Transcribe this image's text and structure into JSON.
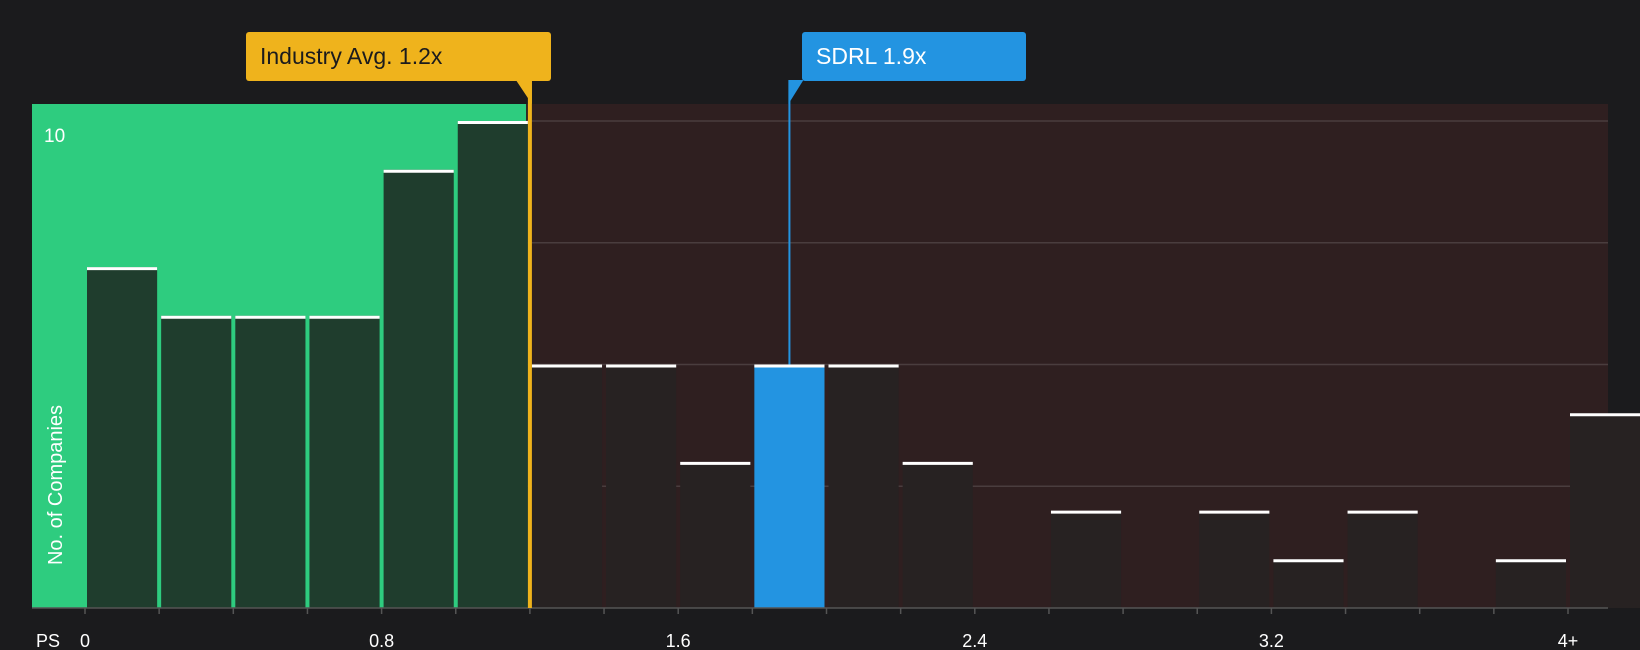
{
  "colors": {
    "background": "#1b1b1d",
    "below_industry_fill": "#2ecc7f",
    "above_industry_fill": "#2f1f20",
    "bar_below": "#1f3d2d",
    "bar_above": "#272222",
    "bar_highlight": "#2394e1",
    "industry_marker": "#efb31c",
    "company_marker": "#2394e1",
    "cap_line": "#ffffff",
    "gridline": "#4a3d3e",
    "axis_text": "#ffffff"
  },
  "callouts": {
    "industry_label": "Industry Avg. 1.2x",
    "company_label": "SDRL 1.9x"
  },
  "chart_data": {
    "type": "bar",
    "x_label": "PS",
    "y_label": "No. of Companies",
    "bin_width": 0.2,
    "x_ticks": [
      {
        "value": 0,
        "label": "0"
      },
      {
        "value": 0.8,
        "label": "0.8"
      },
      {
        "value": 1.6,
        "label": "1.6"
      },
      {
        "value": 2.4,
        "label": "2.4"
      },
      {
        "value": 3.2,
        "label": "3.2"
      },
      {
        "value": 4.0,
        "label": "4+"
      }
    ],
    "y_ticks": [
      {
        "value": 10,
        "label": "10"
      }
    ],
    "ylim": [
      0,
      10
    ],
    "grid_values": [
      2.5,
      5,
      7.5,
      10
    ],
    "industry_avg": 1.2,
    "company_value": 1.9,
    "highlight_bin_start": 1.8,
    "bins": [
      {
        "x": 0.0,
        "value": 7
      },
      {
        "x": 0.2,
        "value": 6
      },
      {
        "x": 0.4,
        "value": 6
      },
      {
        "x": 0.6,
        "value": 6
      },
      {
        "x": 0.8,
        "value": 9
      },
      {
        "x": 1.0,
        "value": 10
      },
      {
        "x": 1.2,
        "value": 5
      },
      {
        "x": 1.4,
        "value": 5
      },
      {
        "x": 1.6,
        "value": 3
      },
      {
        "x": 1.8,
        "value": 5
      },
      {
        "x": 2.0,
        "value": 5
      },
      {
        "x": 2.2,
        "value": 3
      },
      {
        "x": 2.4,
        "value": 0
      },
      {
        "x": 2.6,
        "value": 2
      },
      {
        "x": 2.8,
        "value": 0
      },
      {
        "x": 3.0,
        "value": 2
      },
      {
        "x": 3.2,
        "value": 1
      },
      {
        "x": 3.4,
        "value": 2
      },
      {
        "x": 3.6,
        "value": 0
      },
      {
        "x": 3.8,
        "value": 1
      },
      {
        "x": 4.0,
        "value": 4
      }
    ]
  }
}
